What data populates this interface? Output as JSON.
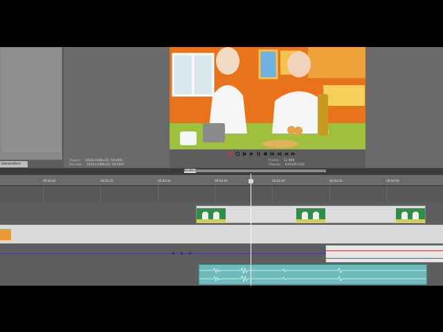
{
  "panels": {
    "left_tab": "Generators"
  },
  "preview": {
    "project_label": "Project:",
    "project_value": "1920x1080x32; 50,000i",
    "preview_label": "Preview:",
    "preview_value": "1920x1080x32; 50,000i",
    "frame_label": "Frame:",
    "frame_value": "12 909",
    "display_label": "Display:",
    "display_value": "635x357x32"
  },
  "transport": {
    "buttons": [
      "record-icon",
      "loop-icon",
      "play-from-start-icon",
      "play-icon",
      "pause-icon",
      "stop-icon",
      "prev-frame-icon",
      "next-frame-icon",
      "go-start-icon",
      "go-end-icon"
    ],
    "accent": "#c43b2a"
  },
  "timeline": {
    "marker_label": "01:03:1",
    "ticks": [
      "00:04:20",
      "00:04:25",
      "00:04:30",
      "00:04:35",
      "00:04:40",
      "00:04:45",
      "00:04:50"
    ]
  },
  "colors": {
    "audio_clip": "#6bb3b4",
    "video_track_bg": "#d9d9d9",
    "envelope": "#3c3c9a"
  }
}
